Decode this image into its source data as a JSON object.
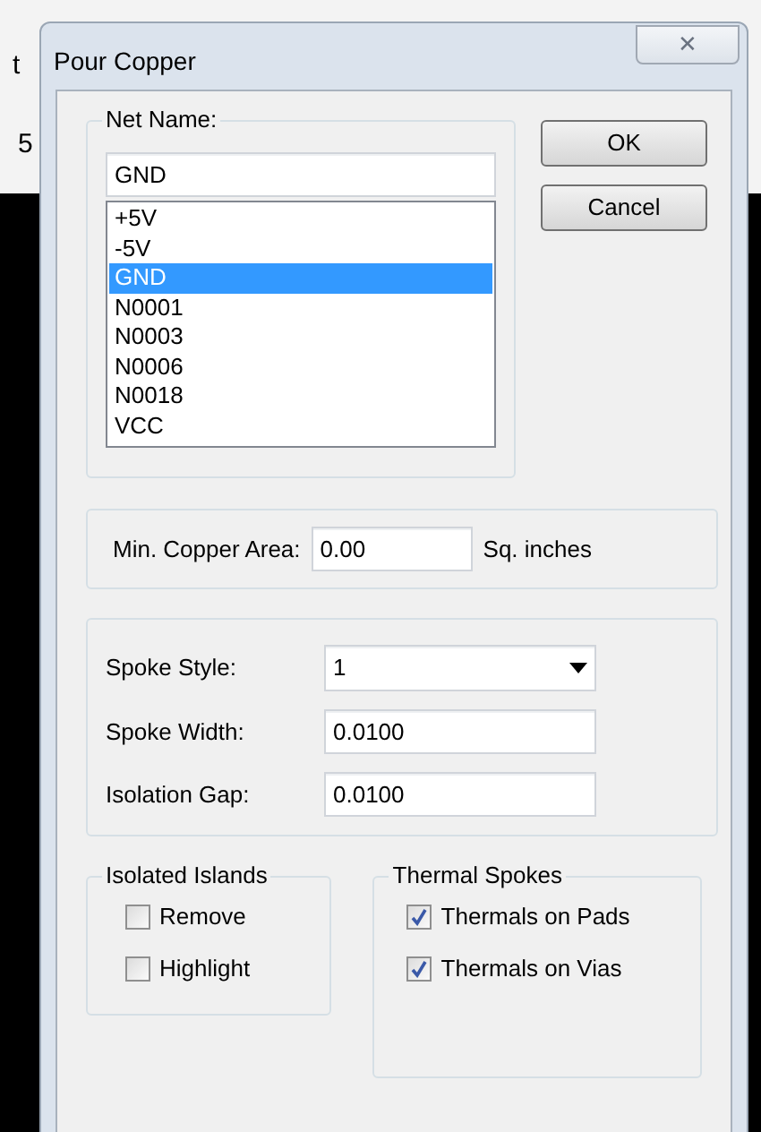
{
  "background": {
    "fragments": [
      "t",
      "5"
    ]
  },
  "window": {
    "title": "Pour Copper",
    "close": "✕"
  },
  "net_name": {
    "label": "Net Name:",
    "value": "GND",
    "items": [
      {
        "label": "+5V",
        "selected": false
      },
      {
        "label": "-5V",
        "selected": false
      },
      {
        "label": "GND",
        "selected": true
      },
      {
        "label": "N0001",
        "selected": false
      },
      {
        "label": "N0003",
        "selected": false
      },
      {
        "label": "N0006",
        "selected": false
      },
      {
        "label": "N0018",
        "selected": false
      },
      {
        "label": "VCC",
        "selected": false
      }
    ]
  },
  "buttons": [
    "OK",
    "Cancel"
  ],
  "min_copper_area": {
    "label": "Min. Copper Area:",
    "value": "0.00",
    "unit": "Sq. inches"
  },
  "spoke": {
    "fields": [
      {
        "kind": "dropdown",
        "label": "Spoke Style:",
        "value": "1"
      },
      {
        "kind": "text",
        "label": "Spoke Width:",
        "value": "0.0100"
      },
      {
        "kind": "text",
        "label": "Isolation Gap:",
        "value": "0.0100"
      }
    ]
  },
  "isolated_islands": {
    "title": "Isolated Islands",
    "options": [
      {
        "label": "Remove",
        "checked": false
      },
      {
        "label": "Highlight",
        "checked": false
      }
    ]
  },
  "thermal_spokes": {
    "title": "Thermal Spokes",
    "options": [
      {
        "label": "Thermals on Pads",
        "checked": true
      },
      {
        "label": "Thermals on Vias",
        "checked": true
      }
    ]
  }
}
